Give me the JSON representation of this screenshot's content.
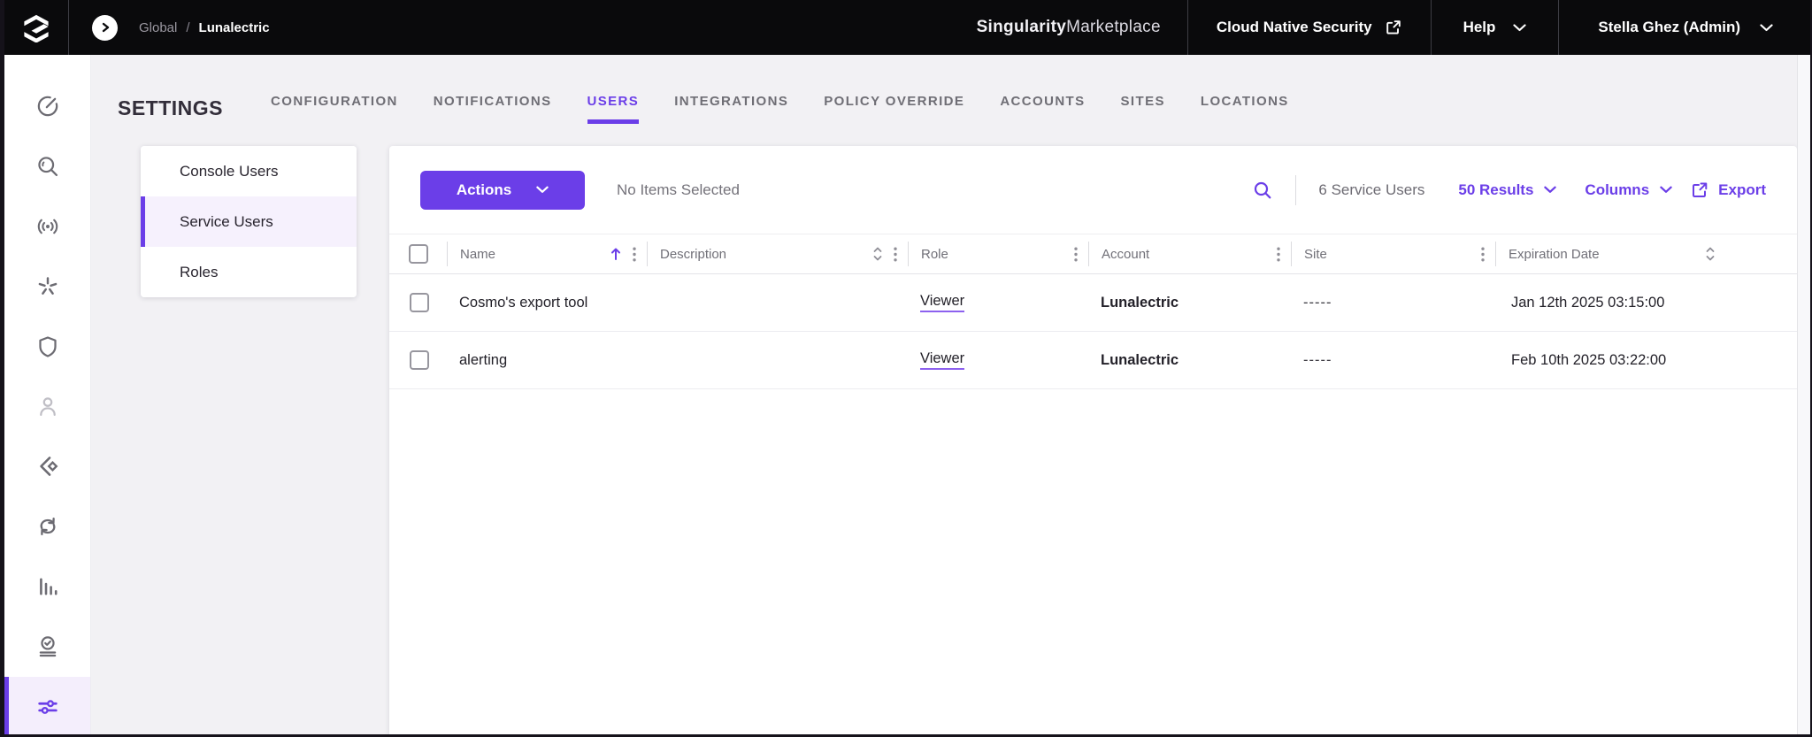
{
  "topbar": {
    "breadcrumb": {
      "root": "Global",
      "separator": "/",
      "current": "Lunalectric"
    },
    "brand": {
      "primary": "Singularity",
      "secondary": "Marketplace"
    },
    "marketplace_link": "Cloud Native Security",
    "help_label": "Help",
    "user_label": "Stella Ghez (Admin)"
  },
  "sidebar": {
    "items": [
      {
        "icon": "gauge"
      },
      {
        "icon": "search"
      },
      {
        "icon": "broadcast"
      },
      {
        "icon": "asterisk"
      },
      {
        "icon": "shield"
      },
      {
        "icon": "user"
      },
      {
        "icon": "code-diamond"
      },
      {
        "icon": "sync"
      },
      {
        "icon": "bar-chart"
      },
      {
        "icon": "rollout-check"
      },
      {
        "icon": "filter-sliders",
        "active": true
      }
    ]
  },
  "settings": {
    "title": "SETTINGS",
    "tabs": [
      {
        "label": "CONFIGURATION"
      },
      {
        "label": "NOTIFICATIONS"
      },
      {
        "label": "USERS",
        "active": true
      },
      {
        "label": "INTEGRATIONS"
      },
      {
        "label": "POLICY OVERRIDE"
      },
      {
        "label": "ACCOUNTS"
      },
      {
        "label": "SITES"
      },
      {
        "label": "LOCATIONS"
      }
    ]
  },
  "subnav": {
    "items": [
      {
        "label": "Console Users"
      },
      {
        "label": "Service Users",
        "active": true
      },
      {
        "label": "Roles"
      }
    ]
  },
  "toolbar": {
    "actions_label": "Actions",
    "selection_status": "No Items Selected",
    "count": "6 Service Users",
    "results": "50 Results",
    "columns": "Columns",
    "export": "Export"
  },
  "table": {
    "columns": [
      {
        "label": "Name",
        "sort": "asc"
      },
      {
        "label": "Description",
        "sort": "sortable"
      },
      {
        "label": "Role"
      },
      {
        "label": "Account"
      },
      {
        "label": "Site"
      },
      {
        "label": "Expiration Date",
        "sort": "sortable"
      }
    ],
    "rows": [
      {
        "name": "Cosmo's export tool",
        "description": "",
        "role": "Viewer",
        "account": "Lunalectric",
        "site": "-----",
        "expiration": "Jan 12th 2025 03:15:00"
      },
      {
        "name": "alerting",
        "description": "",
        "role": "Viewer",
        "account": "Lunalectric",
        "site": "-----",
        "expiration": "Feb 10th 2025 03:22:00"
      }
    ]
  },
  "colors": {
    "accent": "#6b3ee8",
    "topbar_bg": "#0a0a0c",
    "selected_bg": "#f5f0fd"
  }
}
